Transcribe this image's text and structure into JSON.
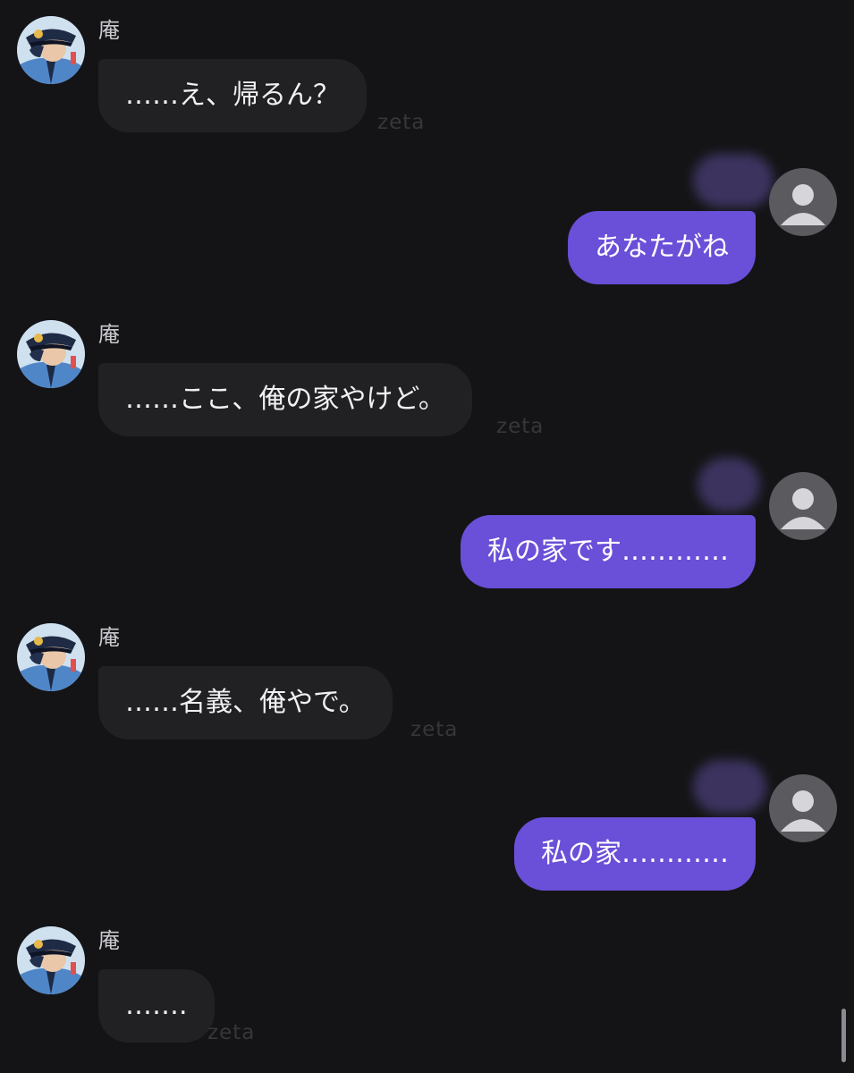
{
  "bot": {
    "name": "庵",
    "watermark": "zeta"
  },
  "messages": [
    {
      "sender": "bot",
      "text": "……え、帰るん？"
    },
    {
      "sender": "user",
      "text": "あなたがね"
    },
    {
      "sender": "bot",
      "text": "……ここ、俺の家やけど。"
    },
    {
      "sender": "user",
      "text": "私の家です…………"
    },
    {
      "sender": "bot",
      "text": "……名義、俺やで。"
    },
    {
      "sender": "user",
      "text": "私の家…………"
    },
    {
      "sender": "bot",
      "text": "……."
    }
  ],
  "icons": {
    "bot_avatar": "police-officer-avatar",
    "user_avatar": "default-user-avatar-icon"
  },
  "colors": {
    "background": "#141416",
    "bot_bubble": "#212124",
    "user_bubble": "#6a4fd8"
  }
}
